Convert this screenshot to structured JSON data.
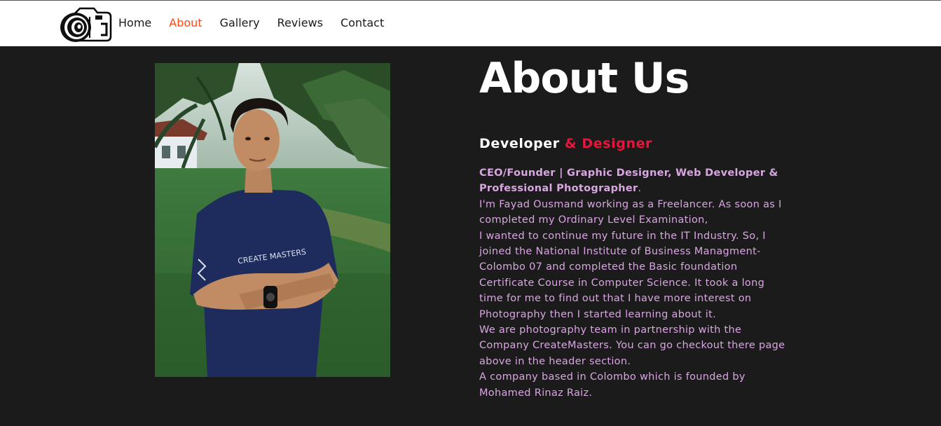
{
  "nav": {
    "logo_icon": "camera-logo-icon",
    "links": [
      {
        "label": "Home"
      },
      {
        "label": "About"
      },
      {
        "label": "Gallery"
      },
      {
        "label": "Reviews"
      },
      {
        "label": "Contact"
      }
    ],
    "active_link": "About",
    "active_color": "#ff4a17"
  },
  "profile": {
    "photo_shirt_text": "CREATE MASTERS"
  },
  "about": {
    "title": "About Us",
    "subtitle_main": "Developer",
    "subtitle_accent": "& Designer",
    "accent_color": "#e5163d",
    "role": "CEO/Founder | Graphic Designer, Web Developer & Professional Photographer",
    "role_end": ".",
    "paragraphs": [
      "I'm Fayad Ousmand working as a Freelancer. As soon as I completed my Ordinary Level Examination,",
      "I wanted to continue my future in the IT Industry. So, I joined the National Institute of Business Managment-Colombo 07 and completed the Basic foundation Certificate Course in Computer Science. It took a long time for me to find out that I have more interest on Photography then I started learning about it.",
      "We are photography team in partnership with the Company CreateMasters. You can go checkout there page above in the header section.",
      "A company based in Colombo which is founded by Mohamed Rinaz Raiz."
    ],
    "text_color": "#d8a6e0"
  }
}
